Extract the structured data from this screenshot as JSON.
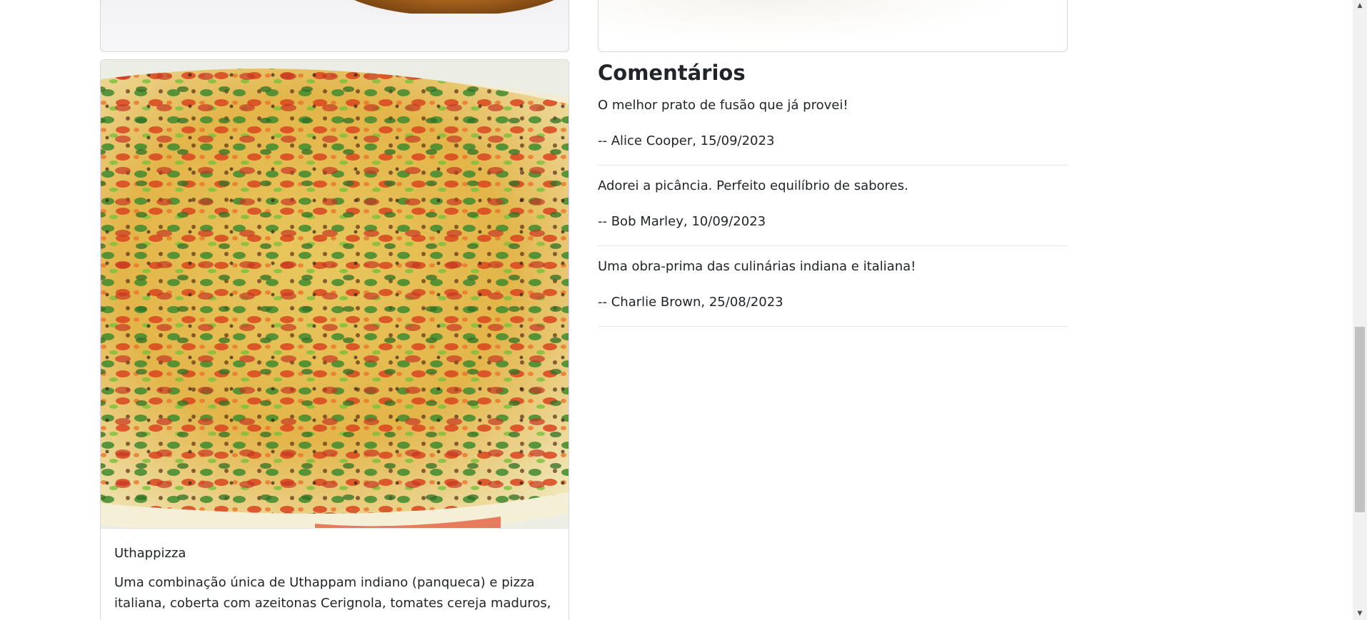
{
  "dish_card": {
    "image_alt": "Uthappizza",
    "title": "Uthappizza",
    "description": "Uma combinação única de Uthappam indiano (panqueca) e pizza italiana, coberta com azeitonas Cerignola, tomates cereja maduros,"
  },
  "comments": {
    "heading": "Comentários",
    "items": [
      {
        "text": "O melhor prato de fusão que já provei!",
        "author_line": "-- Alice Cooper, 15/09/2023"
      },
      {
        "text": "Adorei a picância. Perfeito equilíbrio de sabores.",
        "author_line": "-- Bob Marley, 10/09/2023"
      },
      {
        "text": "Uma obra-prima das culinárias indiana e italiana!",
        "author_line": "-- Charlie Brown, 25/08/2023"
      }
    ]
  },
  "scrollbar": {
    "up_icon": "arrow-up-icon",
    "down_icon": "arrow-down-icon",
    "scroll_position": 0.62
  }
}
